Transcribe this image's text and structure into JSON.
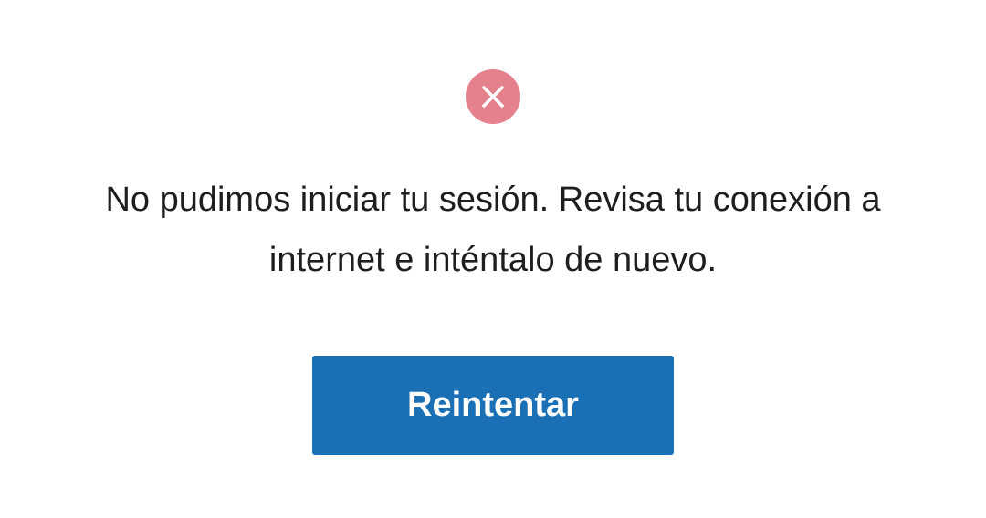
{
  "error": {
    "icon": "close-circle-icon",
    "icon_color": "#e5808d",
    "message_line1": "No pudimos iniciar tu sesión. Revisa tu conexión a",
    "message_line2": "internet e inténtalo de nuevo."
  },
  "actions": {
    "retry_label": "Reintentar",
    "retry_color": "#1b70b5"
  }
}
